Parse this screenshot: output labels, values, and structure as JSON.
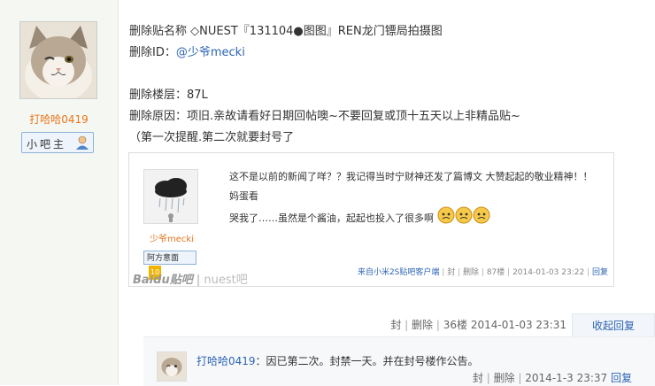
{
  "author": {
    "name": "打哈哈0419",
    "badge": "小吧主"
  },
  "post": {
    "line1_prefix": "删除贴名称",
    "line1_title": "◇NUEST『131104●图图』REN龙门镖局拍摄图",
    "line2_label": "删除ID：",
    "line2_link": "@少爷mecki",
    "line3": "删除楼层：87L",
    "line4": "删除原因：项旧.亲故请看好日期回帖噢~不要回复或顶十五天以上非精品贴~",
    "line5": "（第一次提醒.第二次就要封号了"
  },
  "quote": {
    "user": "少爷mecki",
    "badge": "阿方意面",
    "badge_level": "10",
    "text_line1": "这不是以前的新闻了咩？？我记得当时宁财神还发了篇博文 大赞起起的敬业精神！！ 妈蛋看",
    "text_line2": "哭我了……虽然是个酱油，起起也投入了很多啊",
    "footer_src": "来自小米2S贴吧客户端",
    "footer_sep1": "|",
    "footer_ban": "封",
    "footer_delete": "删除",
    "footer_floor": "87楼",
    "footer_time": "2014-01-03 23:22",
    "footer_reply": "回复",
    "watermark_brand": "Baidu贴吧",
    "watermark_bar": "nuest吧"
  },
  "meta": {
    "ban": "封",
    "delete": "删除",
    "floor": "36楼",
    "time": "2014-01-03 23:31",
    "toggle": "收起回复"
  },
  "reply": {
    "user": "打哈哈0419",
    "text": "：因已第二次。封禁一天。并在封号楼作公告。",
    "ban": "封",
    "delete": "删除",
    "time": "2014-1-3 23:37",
    "reply": "回复"
  },
  "colors": {
    "accent": "#2d64b3",
    "author": "#e8741b"
  }
}
